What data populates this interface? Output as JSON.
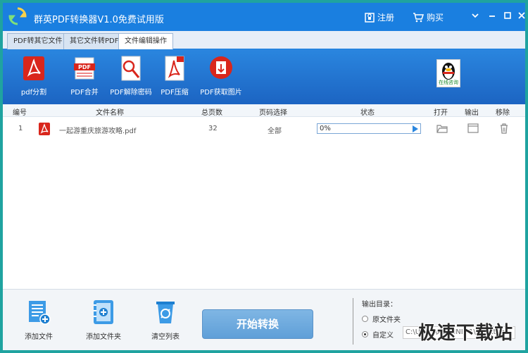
{
  "app": {
    "title": "群英PDF转换器V1.0免费试用版",
    "register_label": "注册",
    "buy_label": "购买"
  },
  "tabs": [
    {
      "label": "PDF转其它文件",
      "active": false
    },
    {
      "label": "其它文件转PDF",
      "active": false
    },
    {
      "label": "文件编辑操作",
      "active": true
    }
  ],
  "toolbar": {
    "items": [
      {
        "label": "pdf分割",
        "icon": "pdf-split-icon"
      },
      {
        "label": "PDF合并",
        "icon": "pdf-merge-icon"
      },
      {
        "label": "PDF解除密码",
        "icon": "pdf-unlock-icon"
      },
      {
        "label": "PDF压缩",
        "icon": "pdf-compress-icon"
      },
      {
        "label": "PDF获取图片",
        "icon": "pdf-extract-image-icon"
      }
    ],
    "qq_label": "在线咨询"
  },
  "table": {
    "headers": [
      "编号",
      "文件名称",
      "总页数",
      "页码选择",
      "状态",
      "打开",
      "输出",
      "移除"
    ],
    "rows": [
      {
        "index": "1",
        "filename": "一起游重庆旅游攻略.pdf",
        "pages": "32",
        "page_select": "全部",
        "progress": 0,
        "progress_text": "0%"
      }
    ]
  },
  "bottom": {
    "add_file_label": "添加文件",
    "add_folder_label": "添加文件夹",
    "clear_list_label": "清空列表",
    "start_label": "开始转换",
    "output_dir_title": "输出目录：",
    "radio_original": "原文件夹",
    "radio_custom": "自定义",
    "custom_path": "C:\\Users\\ADMINI~1\\Desktop",
    "selected_option": "自定义"
  },
  "watermark": "极速下载站",
  "colors": {
    "titlebar": "#1a7fe0",
    "border": "#1fa3a0",
    "start_button": "#6aa8dc"
  }
}
